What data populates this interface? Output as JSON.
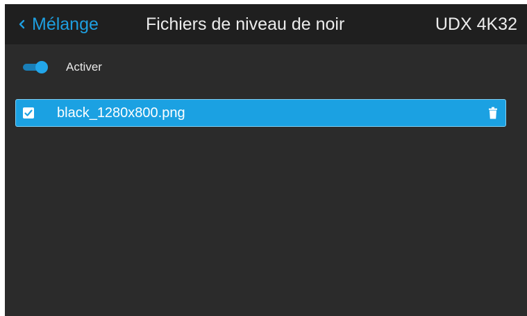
{
  "header": {
    "back_label": "Mélange",
    "title": "Fichiers de niveau de noir",
    "model": "UDX 4K32"
  },
  "toggle": {
    "label": "Activer",
    "state": "on"
  },
  "files": [
    {
      "name": "black_1280x800.png",
      "checked": true,
      "selected": true
    }
  ],
  "colors": {
    "background": "#2b2b2b",
    "header_background": "#1f1f1f",
    "accent": "#1ba1e2",
    "text": "#ececec"
  },
  "icons": {
    "back": "chevron-left-icon",
    "checkbox": "checkbox-checked-icon",
    "delete": "trash-icon"
  }
}
